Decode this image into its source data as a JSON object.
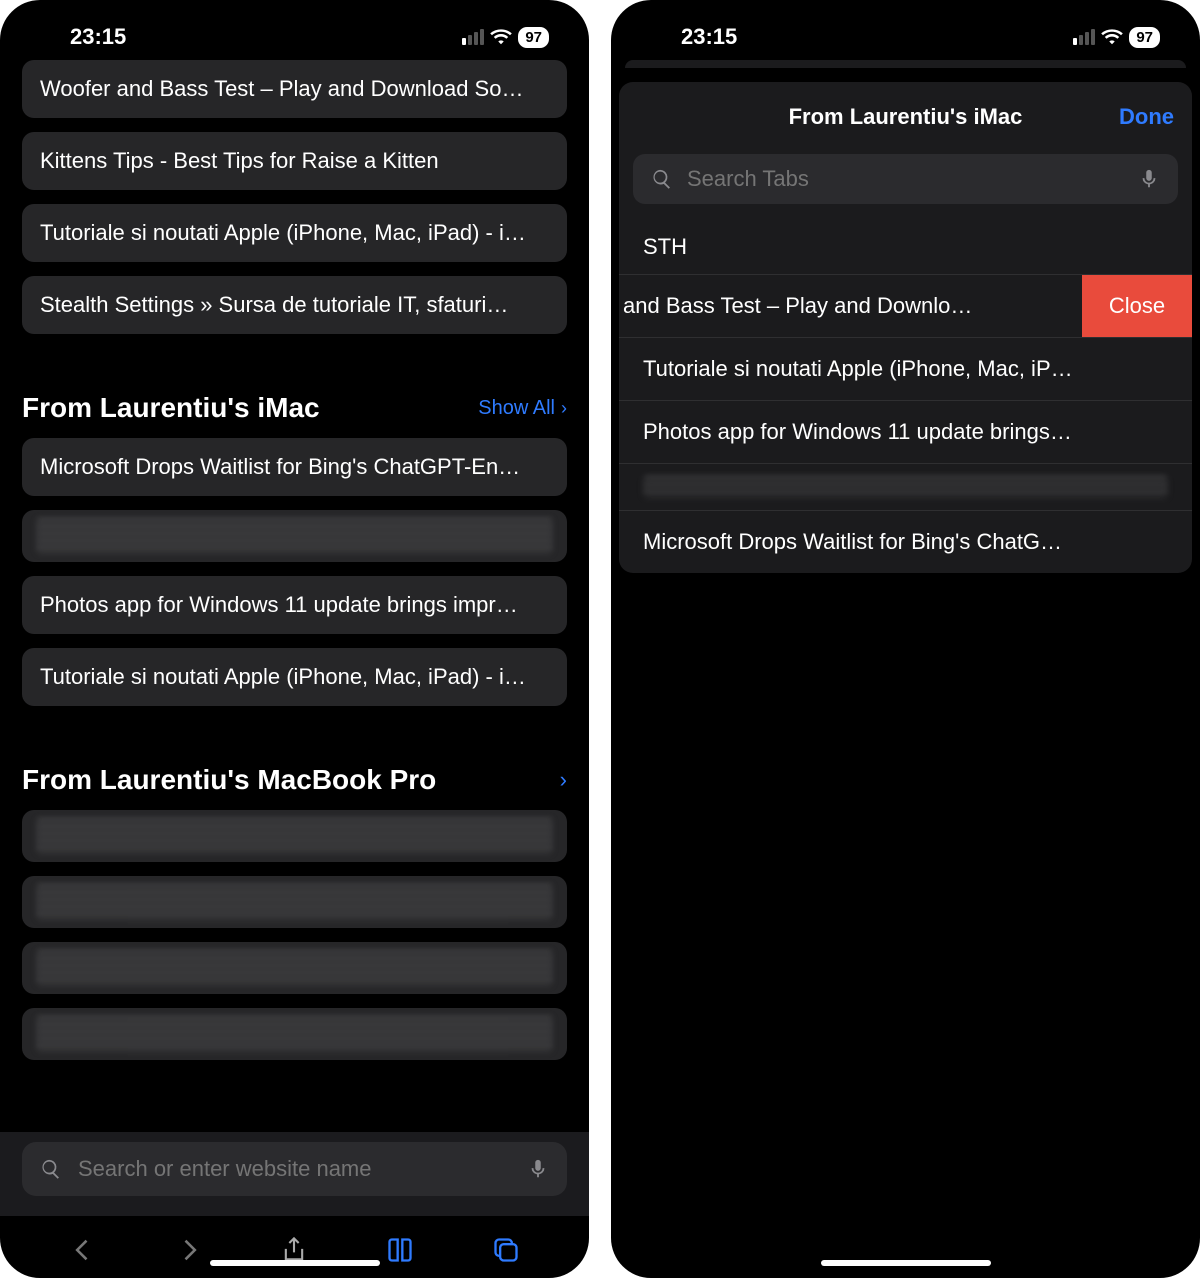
{
  "status": {
    "time": "23:15",
    "battery": "97"
  },
  "left": {
    "top_tabs": [
      "Woofer and Bass Test – Play and Download So…",
      "Kittens Tips - Best Tips for Raise a Kitten",
      "Tutoriale si noutati Apple (iPhone, Mac, iPad) - i…",
      "Stealth Settings » Sursa de tutoriale IT, sfaturi…"
    ],
    "section1_title": "From Laurentiu's iMac",
    "show_all": "Show All",
    "section1_tabs": [
      "Microsoft Drops Waitlist for Bing's ChatGPT-En…",
      "__BLUR__",
      "Photos app for Windows 11 update brings impr…",
      "Tutoriale si noutati Apple (iPhone, Mac, iPad) - i…"
    ],
    "section2_title": "From Laurentiu's MacBook Pro",
    "section2_tabs": [
      "__BLUR__",
      "__BLUR__",
      "__BLUR__",
      "__BLUR__"
    ],
    "search_placeholder": "Search or enter website name"
  },
  "right": {
    "sheet_title": "From Laurentiu's iMac",
    "done": "Done",
    "search_placeholder": "Search Tabs",
    "section_label": "STH",
    "close_label": "Close",
    "rows": [
      {
        "text": "and Bass Test – Play and Downlo…",
        "swiped": true
      },
      {
        "text": "Tutoriale si noutati Apple (iPhone, Mac, iP…"
      },
      {
        "text": "Photos app for Windows 11 update brings…"
      },
      {
        "text": "__BLUR__"
      },
      {
        "text": "Microsoft Drops Waitlist for Bing's ChatG…"
      }
    ]
  }
}
